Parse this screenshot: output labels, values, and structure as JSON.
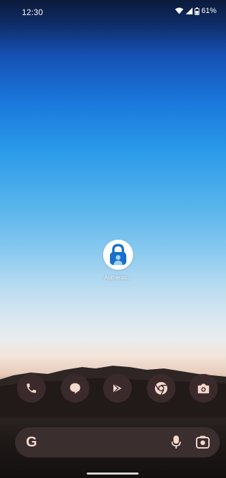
{
  "status_bar": {
    "time": "12:30",
    "battery_text": "61%",
    "icons": [
      "wifi-icon",
      "cell-signal-icon",
      "battery-icon"
    ]
  },
  "home": {
    "apps": [
      {
        "label": "Authentic...",
        "icon": "authenticator-lock-icon"
      }
    ]
  },
  "dock": {
    "items": [
      {
        "name": "phone",
        "icon": "phone-icon"
      },
      {
        "name": "messages",
        "icon": "messages-icon"
      },
      {
        "name": "play-store",
        "icon": "play-store-icon"
      },
      {
        "name": "chrome",
        "icon": "chrome-icon"
      },
      {
        "name": "camera",
        "icon": "camera-icon"
      }
    ]
  },
  "search": {
    "logo": "G",
    "icons": [
      "mic-icon",
      "lens-icon"
    ]
  },
  "colors": {
    "dock_bg": "#3b2a2b",
    "dock_icon": "#f5d7cc",
    "search_bg": "#3a2e2f",
    "authenticator_blue": "#1a6fc9"
  }
}
